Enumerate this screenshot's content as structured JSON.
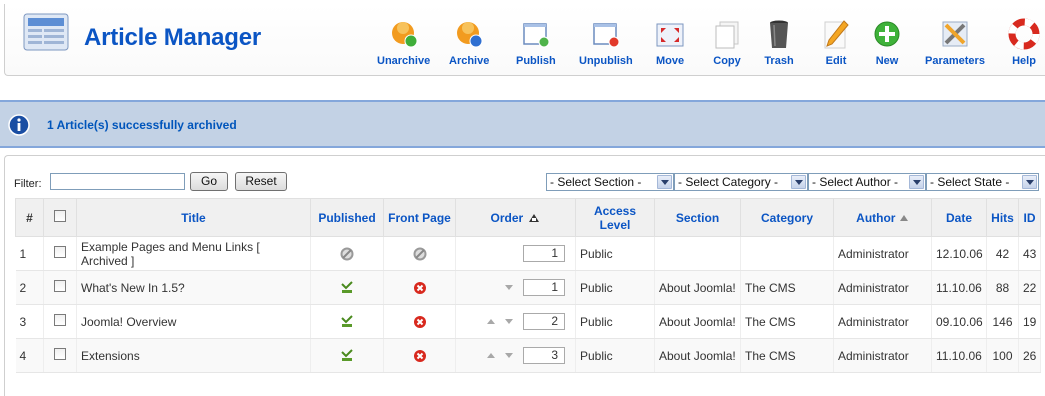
{
  "header": {
    "title": "Article Manager"
  },
  "toolbar": {
    "buttons": [
      {
        "label": "Unarchive",
        "icon": "unarchive-icon"
      },
      {
        "label": "Archive",
        "icon": "archive-icon"
      },
      {
        "label": "Publish",
        "icon": "publish-icon"
      },
      {
        "label": "Unpublish",
        "icon": "unpublish-icon"
      },
      {
        "label": "Move",
        "icon": "move-icon"
      },
      {
        "label": "Copy",
        "icon": "copy-icon"
      },
      {
        "label": "Trash",
        "icon": "trash-icon"
      },
      {
        "label": "Edit",
        "icon": "edit-icon"
      },
      {
        "label": "New",
        "icon": "new-icon"
      },
      {
        "label": "Parameters",
        "icon": "parameters-icon"
      },
      {
        "label": "Help",
        "icon": "help-icon"
      }
    ]
  },
  "message": {
    "text": "1 Article(s) successfully archived"
  },
  "filter": {
    "label": "Filter:",
    "input_value": "",
    "go_label": "Go",
    "reset_label": "Reset",
    "selects": [
      "- Select Section -",
      "- Select Category -",
      "- Select Author -",
      "- Select State -"
    ]
  },
  "table": {
    "headers": {
      "num": "#",
      "title": "Title",
      "published": "Published",
      "front_page": "Front Page",
      "order": "Order",
      "access_level": "Access Level",
      "section": "Section",
      "category": "Category",
      "author": "Author",
      "date": "Date",
      "hits": "Hits",
      "id": "ID"
    },
    "rows": [
      {
        "num": "1",
        "title": "Example Pages and Menu Links [ Archived ]",
        "published": "archived",
        "front_page": "archived",
        "order": "1",
        "access": "Public",
        "section": "",
        "category": "",
        "author": "Administrator",
        "date": "12.10.06",
        "hits": "42",
        "id": "43"
      },
      {
        "num": "2",
        "title": "What's New In 1.5?",
        "published": "published",
        "front_page": "no",
        "order": "1",
        "access": "Public",
        "section": "About Joomla!",
        "category": "The CMS",
        "author": "Administrator",
        "date": "11.10.06",
        "hits": "88",
        "id": "22"
      },
      {
        "num": "3",
        "title": "Joomla! Overview",
        "published": "published",
        "front_page": "no",
        "order": "2",
        "access": "Public",
        "section": "About Joomla!",
        "category": "The CMS",
        "author": "Administrator",
        "date": "09.10.06",
        "hits": "146",
        "id": "19"
      },
      {
        "num": "4",
        "title": "Extensions",
        "published": "published",
        "front_page": "no",
        "order": "3",
        "access": "Public",
        "section": "About Joomla!",
        "category": "The CMS",
        "author": "Administrator",
        "date": "11.10.06",
        "hits": "100",
        "id": "26"
      }
    ]
  },
  "colors": {
    "link": "#0b55c4",
    "public": "#008000",
    "message_bg": "#c3d2e5",
    "header_bg": "#f0f0f0"
  }
}
